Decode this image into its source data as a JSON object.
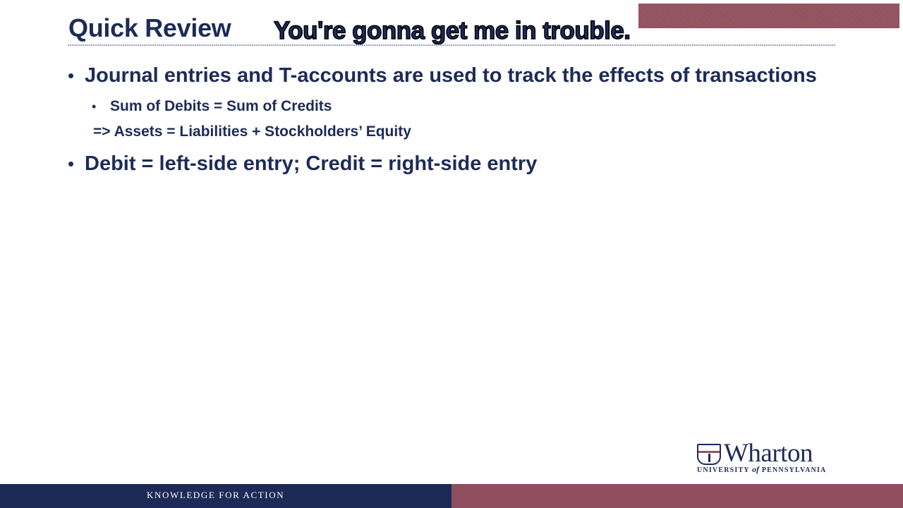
{
  "slide": {
    "title": "Quick Review",
    "caption": "You're gonna get me in trouble.",
    "bullets": [
      {
        "text": "Journal entries and T-accounts are used to track the effects of transactions",
        "sub": [
          "Sum of Debits = Sum of Credits",
          "=> Assets = Liabilities + Stockholders’ Equity"
        ]
      },
      {
        "text": "Debit = left-side entry; Credit = right-side entry"
      }
    ],
    "bullet_char": "•"
  },
  "logo": {
    "wordmark": "Wharton",
    "university_pre": "UNIVERSITY ",
    "university_of": "of",
    "university_post": " PENNSYLVANIA"
  },
  "footer": {
    "tagline": "KNOWLEDGE FOR ACTION"
  },
  "colors": {
    "navy": "#1d2957",
    "maroon": "#8f4e5d",
    "text": "#1d2b57"
  }
}
